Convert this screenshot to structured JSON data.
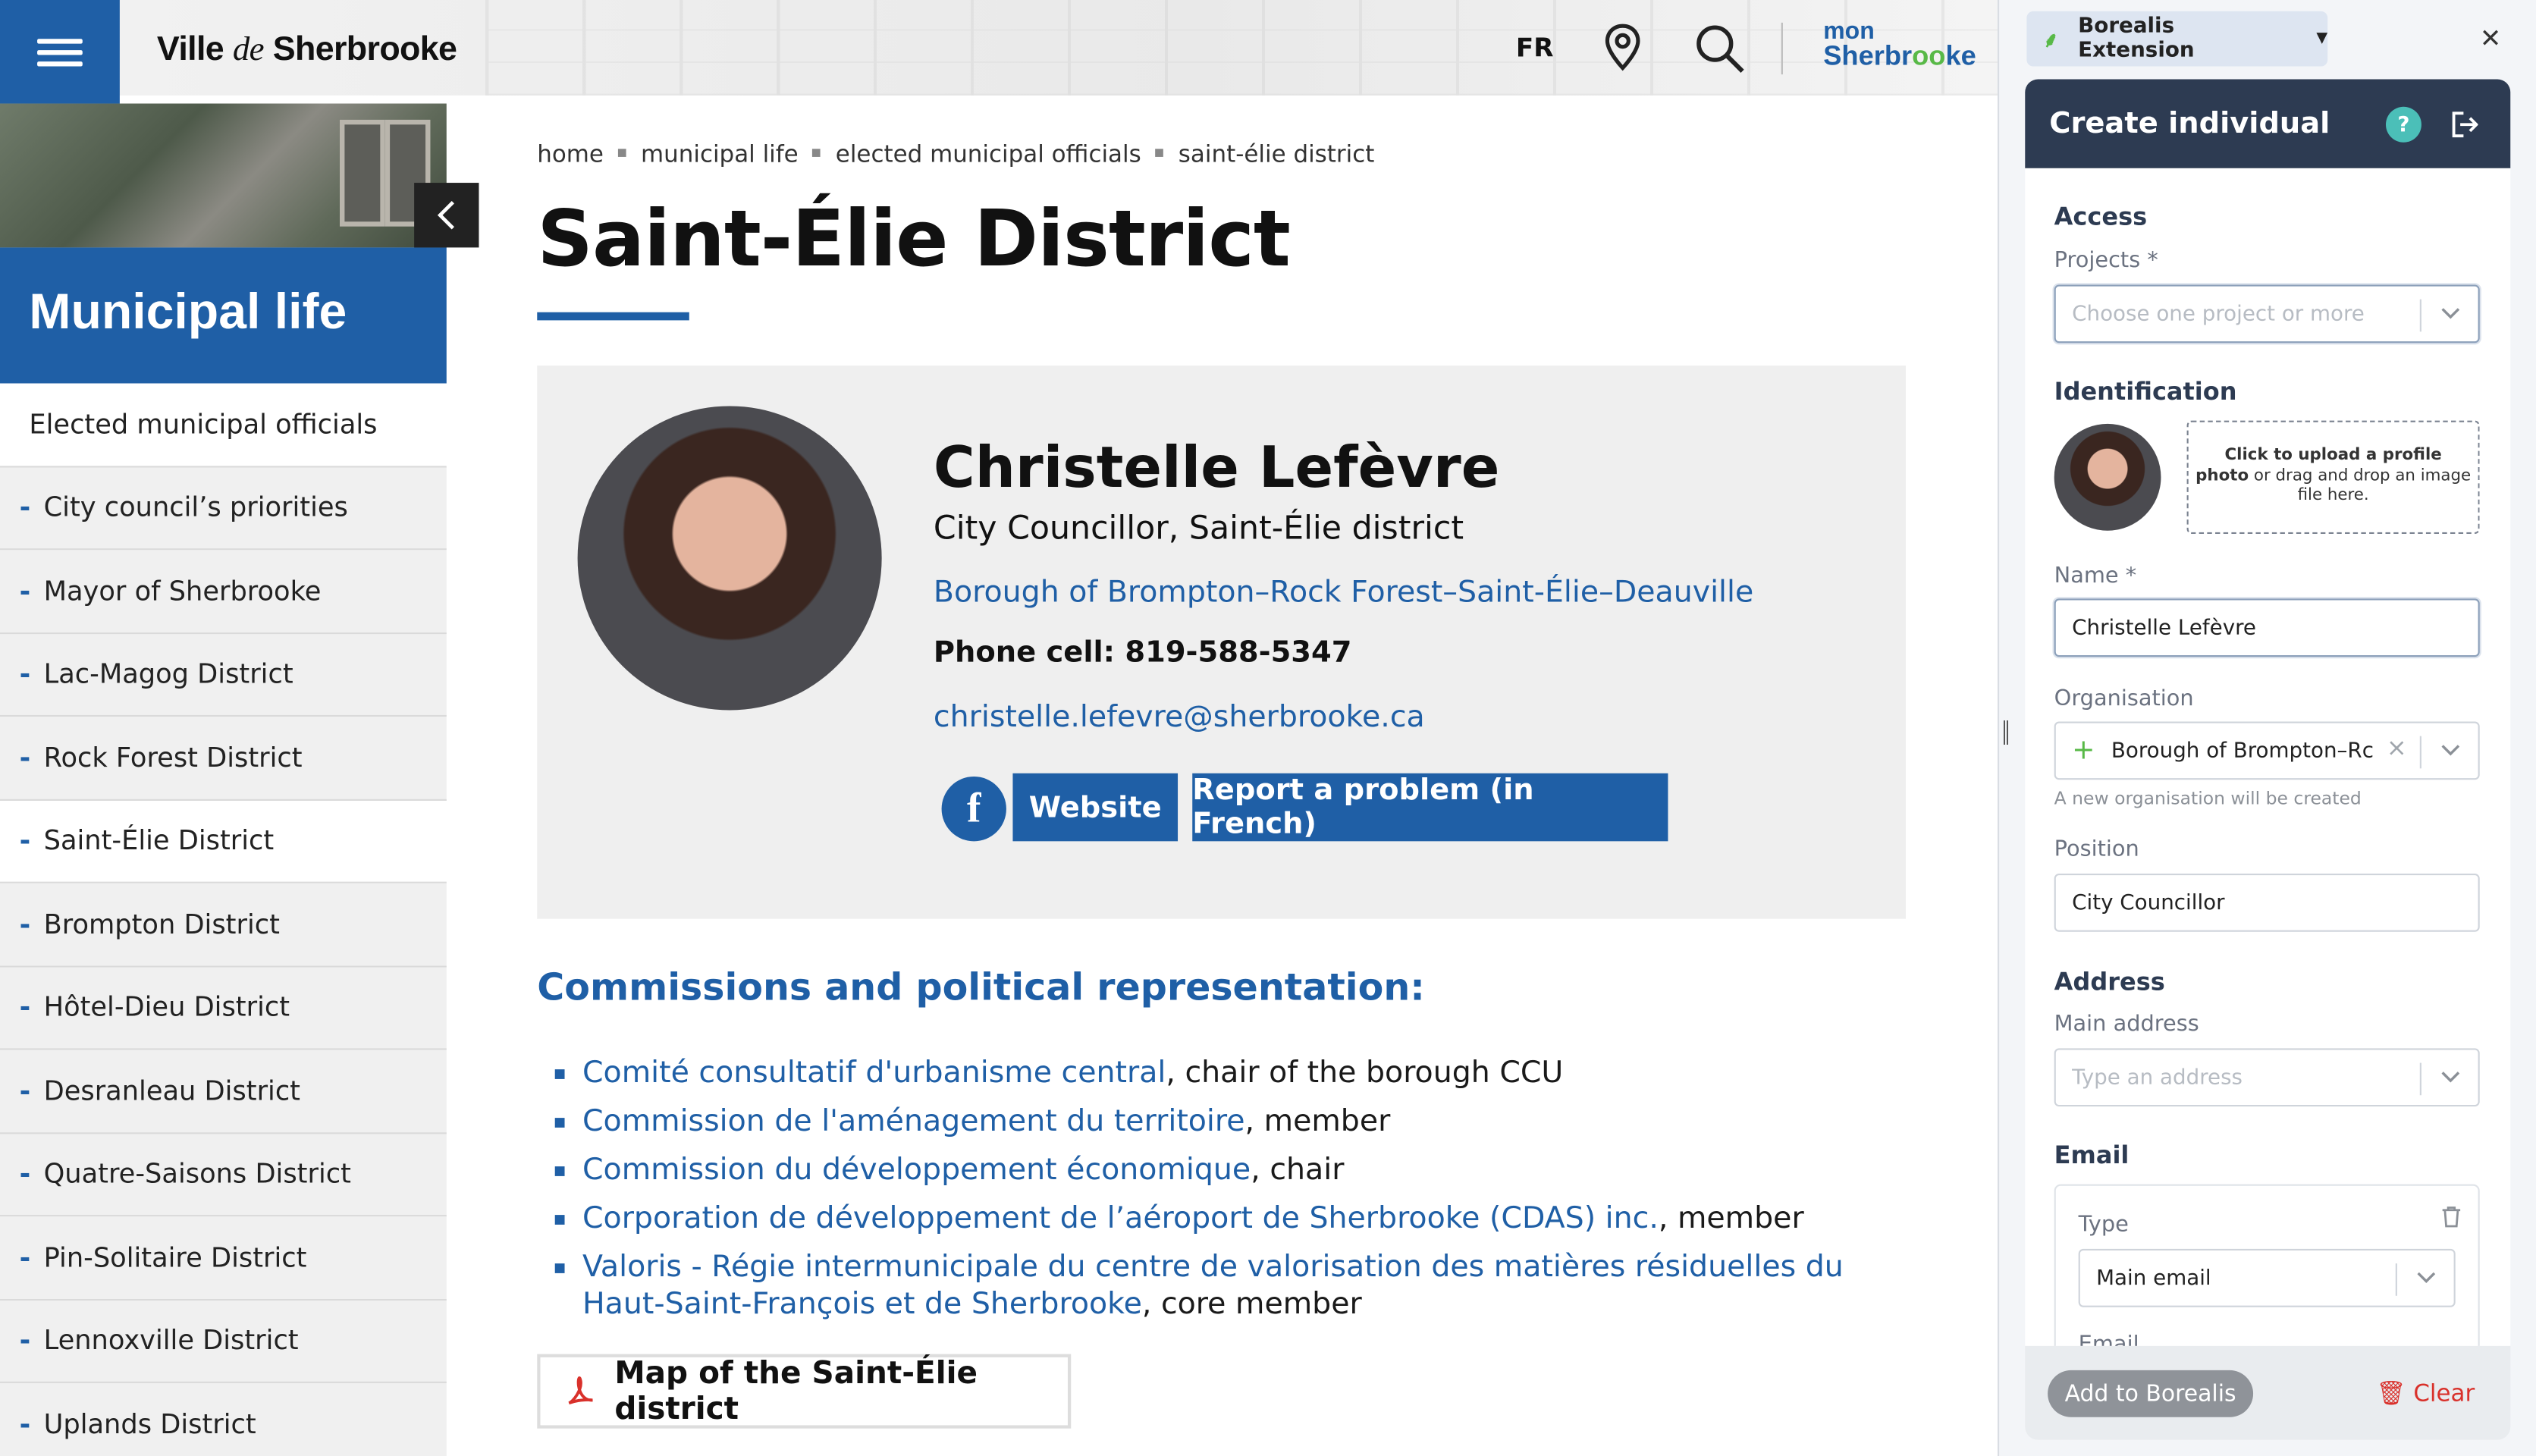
{
  "site": {
    "logo": {
      "ville": "Ville",
      "de": "de",
      "name": "Sherbrooke"
    },
    "header": {
      "lang": "FR",
      "mon_line1": "mon",
      "mon_line2_a": "Sherbr",
      "mon_line2_o": "oo",
      "mon_line2_b": "ke"
    },
    "nav": {
      "title": "Municipal life",
      "head": "Elected municipal officials",
      "items": [
        "City council’s priorities",
        "Mayor of Sherbrooke",
        "Lac-Magog District",
        "Rock Forest District",
        "Saint-Élie District",
        "Brompton District",
        "Hôtel-Dieu District",
        "Desranleau District",
        "Quatre-Saisons District",
        "Pin-Solitaire District",
        "Lennoxville District",
        "Uplands District"
      ]
    },
    "breadcrumb": [
      "home",
      "municipal life",
      "elected municipal officials",
      "saint-élie district"
    ],
    "title": "Saint-Élie District",
    "official": {
      "name": "Christelle Lefèvre",
      "role": "City Councillor, Saint-Élie district",
      "borough": "Borough of Brompton–Rock Forest–Saint-Élie–Deauville",
      "phone": "Phone cell: 819-588-5347",
      "email": "christelle.lefevre@sherbrooke.ca",
      "facebook_glyph": "f",
      "website_label": "Website",
      "report_label": "Report a problem (in French)"
    },
    "commissions_heading": "Commissions and political representation:",
    "commissions": [
      {
        "link": "Comité consultatif d'urbanisme central",
        "rest": ", chair of the borough CCU"
      },
      {
        "link": "Commission de l'aménagement du territoire",
        "rest": ", member"
      },
      {
        "link": "Commission du développement économique",
        "rest": ", chair"
      },
      {
        "link": "Corporation de développement de l’aéroport de Sherbrooke (CDAS) inc.",
        "rest": ", member"
      },
      {
        "link": "Valoris - Régie intermunicipale du centre de valorisation des matières résiduelles du Haut-Saint-François et de Sherbrooke",
        "rest": ", core member"
      }
    ],
    "map_button": "Map of the Saint-Élie district"
  },
  "extension": {
    "selector": "Borealis Extension",
    "panel_title": "Create individual",
    "help_glyph": "?",
    "access_heading": "Access",
    "projects_label": "Projects *",
    "projects_placeholder": "Choose one project or more",
    "identification_heading": "Identification",
    "upload_bold1": "Click to upload a profile",
    "upload_bold2": "photo",
    "upload_rest": " or drag and drop an image file here.",
    "name_label": "Name *",
    "name_value": "Christelle Lefèvre",
    "organisation_label": "Organisation",
    "organisation_value": "Borough of Brompton–Rc",
    "organisation_hint": "A new organisation will be created",
    "position_label": "Position",
    "position_value": "City Councillor",
    "address_heading": "Address",
    "main_address_label": "Main address",
    "address_placeholder": "Type an address",
    "email_heading": "Email",
    "email_type_label": "Type",
    "email_type_value": "Main email",
    "email_label_cut": "Email",
    "add_button": "Add to Borealis",
    "clear_button": "Clear"
  },
  "colors": {
    "brand_blue": "#1f5fa6",
    "panel_dark": "#2d3b52",
    "accent_green": "#58b947",
    "danger_red": "#d9312b"
  }
}
